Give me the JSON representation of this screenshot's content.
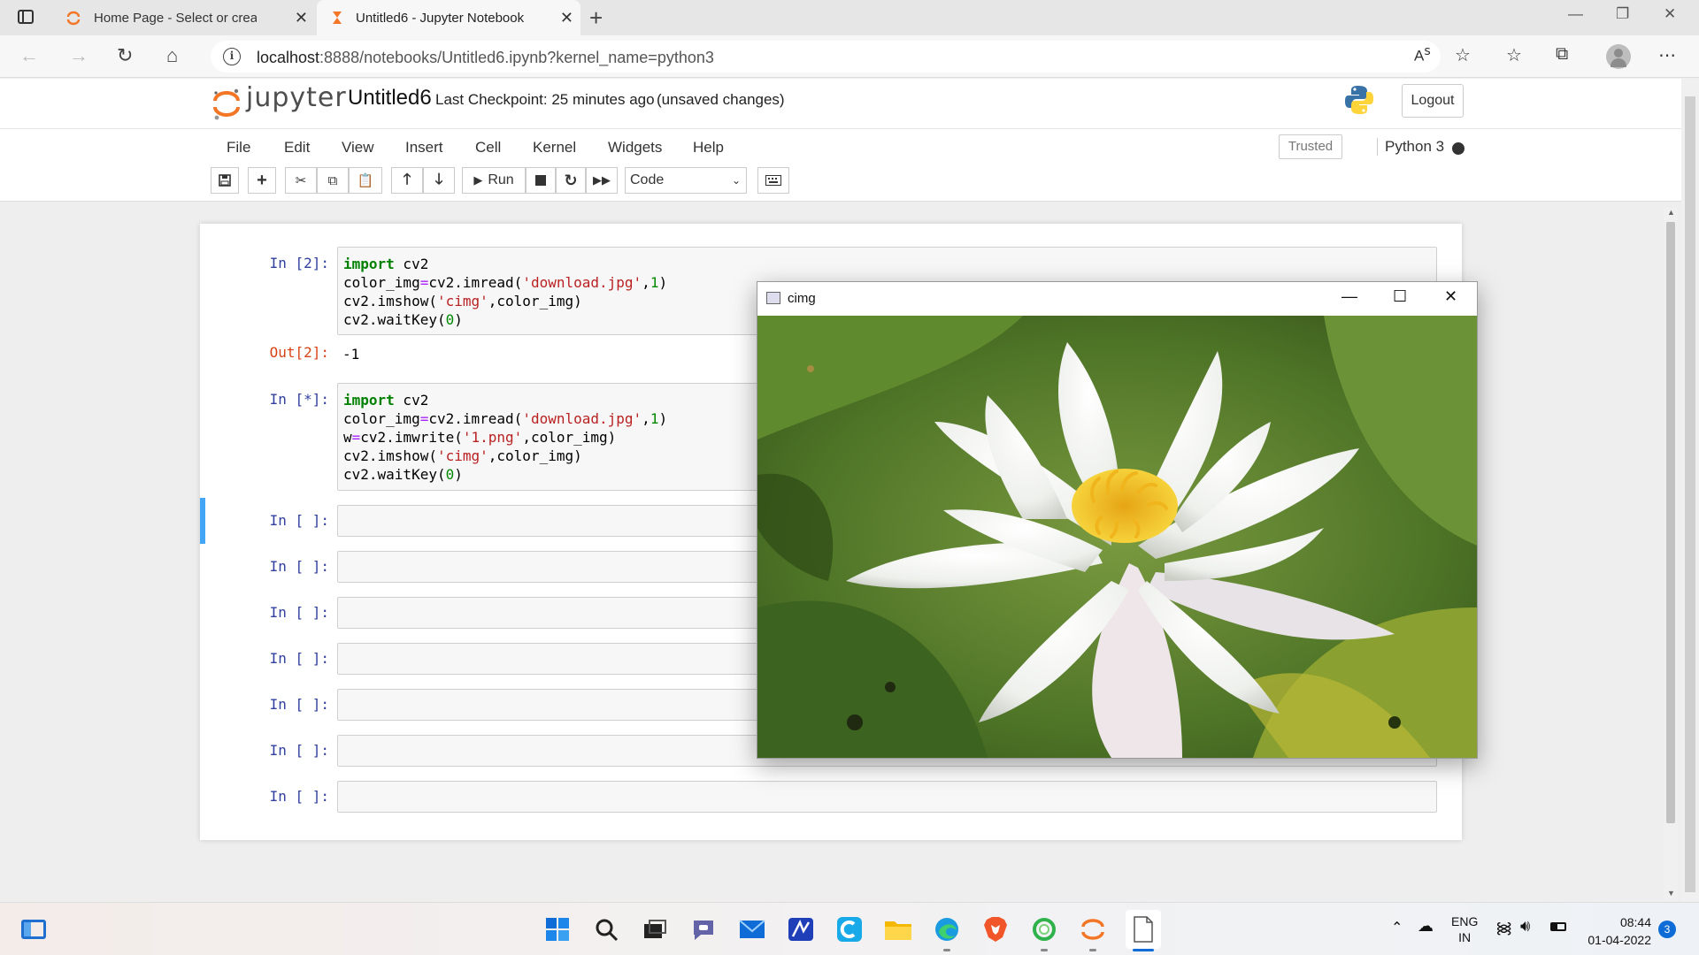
{
  "browser": {
    "tabs": [
      {
        "title": "Home Page - Select or create a n",
        "active": false
      },
      {
        "title": "Untitled6 - Jupyter Notebook",
        "active": true
      }
    ],
    "url_host": "localhost",
    "url_rest": ":8888/notebooks/Untitled6.ipynb?kernel_name=python3"
  },
  "jupyter": {
    "logo_text": "jupyter",
    "notebook_name": "Untitled6",
    "checkpoint": "Last Checkpoint: 25 minutes ago",
    "unsaved": "(unsaved changes)",
    "logout": "Logout",
    "menu": [
      "File",
      "Edit",
      "View",
      "Insert",
      "Cell",
      "Kernel",
      "Widgets",
      "Help"
    ],
    "trusted": "Trusted",
    "kernel": "Python 3",
    "run_label": "Run",
    "cell_type": "Code"
  },
  "cells": {
    "c1_prompt": "In [2]:",
    "c1_out_prompt": "Out[2]:",
    "c1_output": "-1",
    "c2_prompt": "In [*]:",
    "empty_prompt": "In [ ]:"
  },
  "image_window": {
    "title": "cimg"
  },
  "taskbar": {
    "lang1": "ENG",
    "lang2": "IN",
    "time": "08:44",
    "date": "01-04-2022",
    "notifications": "3"
  },
  "colors": {
    "jupyter_orange": "#f37626",
    "prompt_in": "#303f9f",
    "prompt_out": "#d84315",
    "selected_cell": "#42a5f5"
  }
}
